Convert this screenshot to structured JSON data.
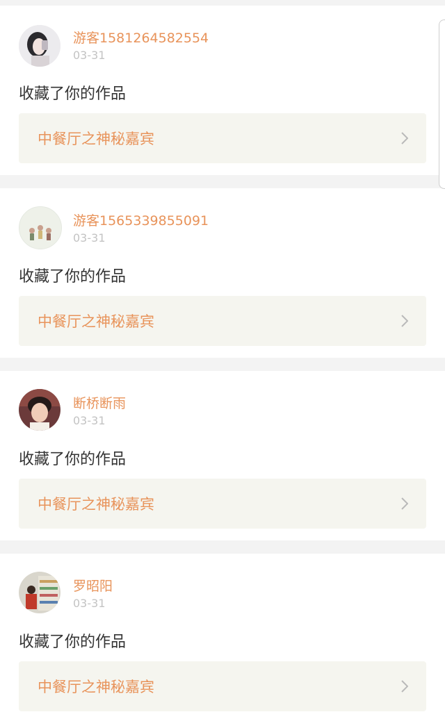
{
  "notifications": [
    {
      "username": "游客1581264582554",
      "date": "03-31",
      "action": "收藏了你的作品",
      "work_title": "中餐厅之神秘嘉宾",
      "avatar_icon": "avatar-photo-girl"
    },
    {
      "username": "游客1565339855091",
      "date": "03-31",
      "action": "收藏了你的作品",
      "work_title": "中餐厅之神秘嘉宾",
      "avatar_icon": "avatar-illustration-figures"
    },
    {
      "username": "断桥断雨",
      "date": "03-31",
      "action": "收藏了你的作品",
      "work_title": "中餐厅之神秘嘉宾",
      "avatar_icon": "avatar-photo-boy"
    },
    {
      "username": "罗昭阳",
      "date": "03-31",
      "action": "收藏了你的作品",
      "work_title": "中餐厅之神秘嘉宾",
      "avatar_icon": "avatar-photo-store"
    }
  ],
  "colors": {
    "accent": "#e8935a",
    "date_gray": "#c3c3c3",
    "text": "#333333",
    "link_bg": "#f5f5ef",
    "page_bg": "#f3f3f3"
  }
}
